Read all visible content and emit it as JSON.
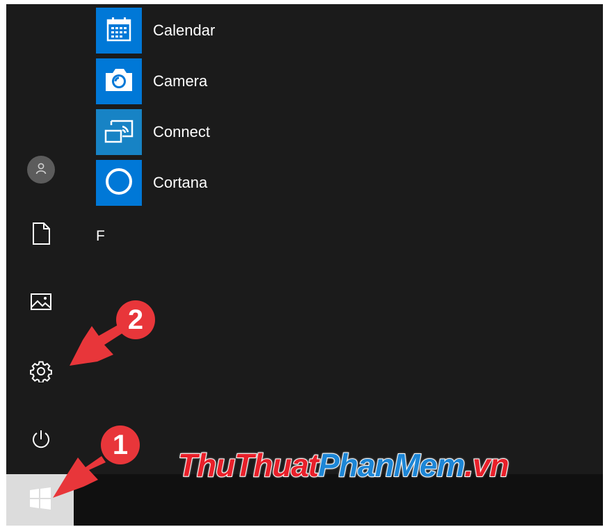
{
  "start_menu": {
    "apps": [
      {
        "label": "Calendar",
        "icon": "calendar-icon",
        "tile_color": "#0078d7"
      },
      {
        "label": "Camera",
        "icon": "camera-icon",
        "tile_color": "#0078d7"
      },
      {
        "label": "Connect",
        "icon": "connect-icon",
        "tile_color": "#1783c5"
      },
      {
        "label": "Cortana",
        "icon": "cortana-icon",
        "tile_color": "#0078d7"
      }
    ],
    "group_letter": "F",
    "rail": {
      "items": [
        {
          "name": "user-account",
          "icon": "user-icon"
        },
        {
          "name": "documents",
          "icon": "document-icon"
        },
        {
          "name": "pictures",
          "icon": "picture-icon"
        },
        {
          "name": "settings",
          "icon": "gear-icon"
        },
        {
          "name": "power",
          "icon": "power-icon"
        }
      ]
    }
  },
  "taskbar": {
    "start_icon": "windows-logo-icon"
  },
  "annotations": {
    "step1": "1",
    "step2": "2",
    "color": "#e8363a"
  },
  "watermark": {
    "part1": "ThuThuat",
    "part2": "PhanMem",
    "part3": ".vn",
    "color1": "#e8202a",
    "color2": "#1d86d6",
    "color3": "#e8202a"
  }
}
